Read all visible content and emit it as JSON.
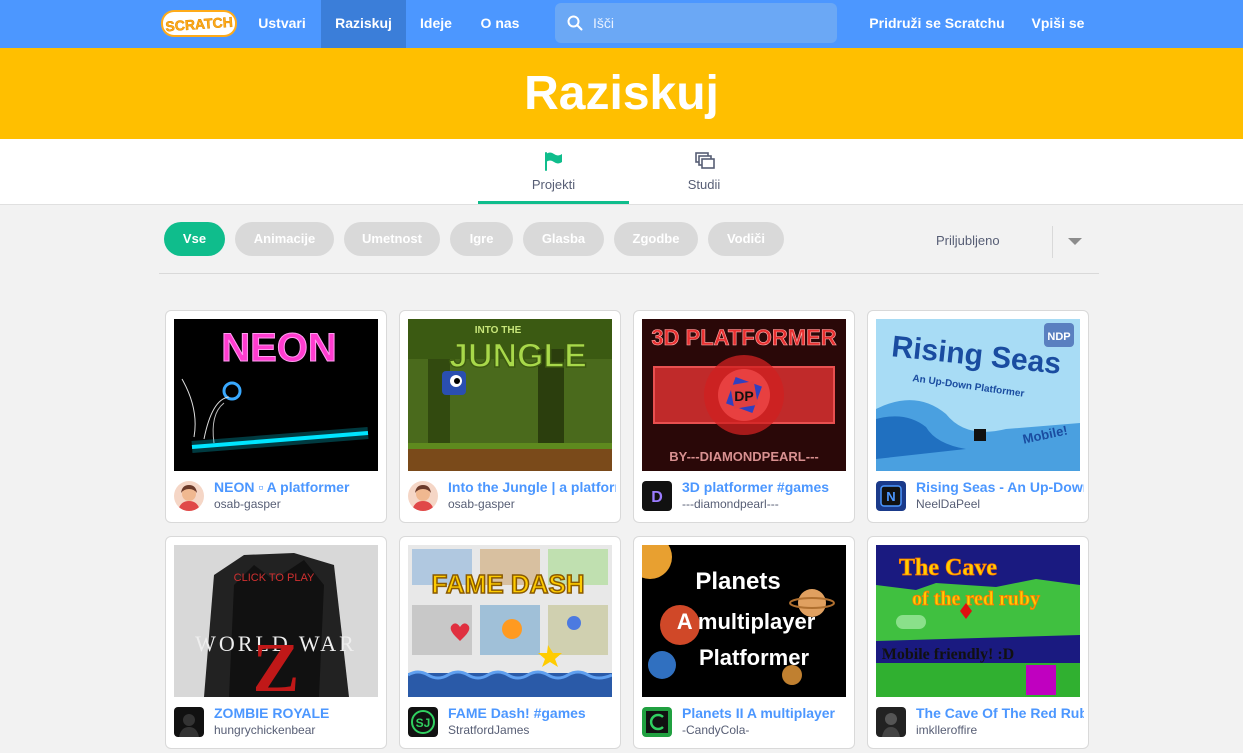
{
  "nav": {
    "logo_text": "SCRATCH",
    "links": [
      "Ustvari",
      "Raziskuj",
      "Ideje",
      "O nas"
    ],
    "search_placeholder": "Išči",
    "join": "Pridruži se Scratchu",
    "signin": "Vpiši se"
  },
  "banner": {
    "title": "Raziskuj"
  },
  "tabs": [
    {
      "label": "Projekti",
      "icon": "flag-icon"
    },
    {
      "label": "Studii",
      "icon": "studio-icon"
    }
  ],
  "filters": [
    "Vse",
    "Animacije",
    "Umetnost",
    "Igre",
    "Glasba",
    "Zgodbe",
    "Vodiči"
  ],
  "sort": {
    "label": "Priljubljeno"
  },
  "thumb_texts": {
    "neon": "NEON",
    "jungle_top": "INTO THE",
    "jungle": "JUNGLE",
    "platformer3d": "3D PLATFORMER",
    "dp": "DP",
    "byline": "BY---DIAMONDPEARL---",
    "rising": "Rising Seas",
    "rising_sub": "An Up-Down Platformer",
    "mobile": "Mobile!",
    "ndp": "NDP",
    "click_play": "CLICK TO PLAY",
    "world_war": "WORLD WAR",
    "z": "Z",
    "fame": "FAME DASH",
    "planets": "Planets",
    "planets2": "A multiplayer",
    "planets3": "Platformer",
    "cave1": "The Cave",
    "cave2": "of the red ruby",
    "cave3": "Mobile friendly! :D"
  },
  "projects": [
    {
      "title": "NEON ▫ A platformer",
      "user": "osab-gasper"
    },
    {
      "title": "Into the Jungle | a platformer",
      "user": "osab-gasper"
    },
    {
      "title": "3D platformer #games",
      "user": "---diamondpearl---"
    },
    {
      "title": "Rising Seas - An Up-Down Platformer",
      "user": "NeelDaPeel"
    },
    {
      "title": "ZOMBIE ROYALE",
      "user": "hungrychickenbear"
    },
    {
      "title": "FAME Dash! #games",
      "user": "StratfordJames"
    },
    {
      "title": "Planets II A multiplayer",
      "user": "-CandyCola-"
    },
    {
      "title": "The Cave Of The Red Ruby",
      "user": "imklleroffire"
    }
  ],
  "colors": {
    "nav": "#4c97ff",
    "banner": "#ffbf00",
    "accent": "#0fbd8c",
    "link": "#4c97ff"
  }
}
